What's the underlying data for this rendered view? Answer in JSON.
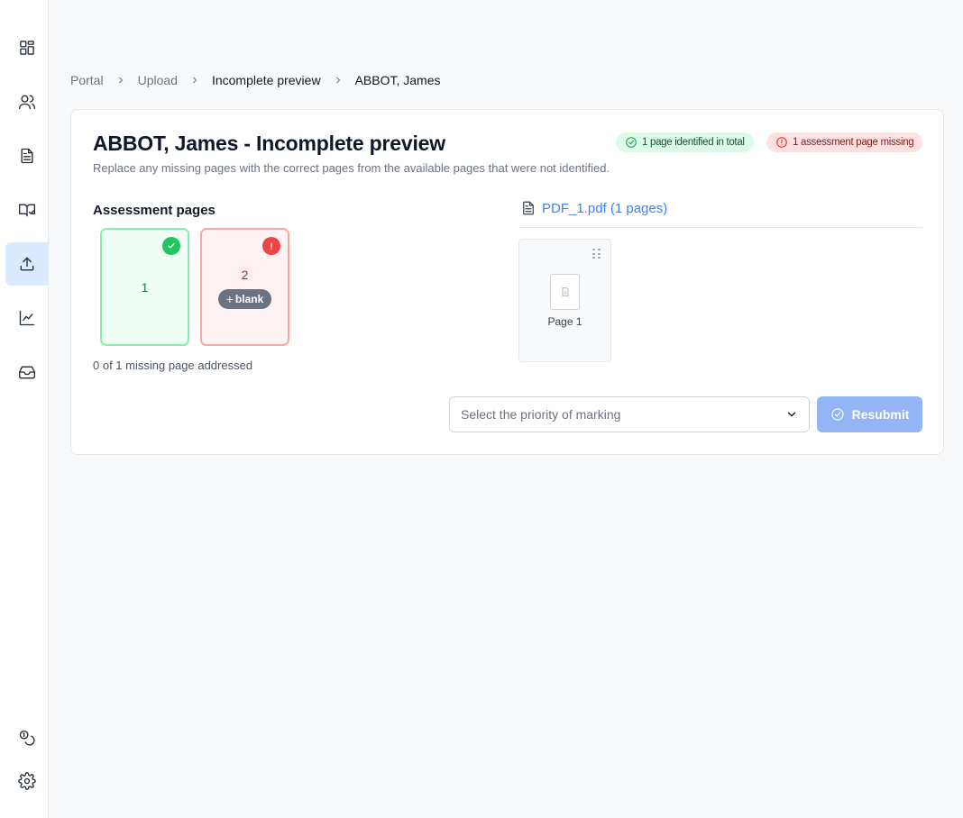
{
  "sidebar": {
    "items": [
      {
        "icon": "dashboard-icon"
      },
      {
        "icon": "users-icon"
      },
      {
        "icon": "document-icon"
      },
      {
        "icon": "book-check-icon"
      },
      {
        "icon": "upload-icon",
        "active": true
      },
      {
        "icon": "chart-line-icon"
      },
      {
        "icon": "inbox-icon"
      }
    ],
    "bottom_items": [
      {
        "icon": "coins-icon"
      },
      {
        "icon": "gear-icon"
      }
    ]
  },
  "breadcrumb": [
    "Portal",
    "Upload",
    "Incomplete preview",
    "ABBOT, James"
  ],
  "card": {
    "title": "ABBOT, James - Incomplete preview",
    "subtitle": "Replace any missing pages with the correct pages from the available pages that were not identified.",
    "badges": {
      "identified": "1 page identified in total",
      "missing": "1 assessment page missing"
    },
    "assessment": {
      "heading": "Assessment pages",
      "pages": [
        {
          "number": "1",
          "status": "identified"
        },
        {
          "number": "2",
          "status": "missing",
          "action": "blank"
        }
      ],
      "missing_summary": "0 of 1 missing page addressed"
    },
    "pdf": {
      "file_label": "PDF_1.pdf (1 pages)",
      "pages": [
        {
          "label": "Page 1"
        }
      ]
    },
    "priority_select": {
      "placeholder": "Select the priority of marking"
    },
    "resubmit_label": "Resubmit"
  },
  "colors": {
    "accent": "#3b82f6",
    "active_nav_bg": "#dbeafe",
    "success": "#22c55e",
    "error": "#ef4444",
    "button_disabled": "#93b4f5"
  }
}
